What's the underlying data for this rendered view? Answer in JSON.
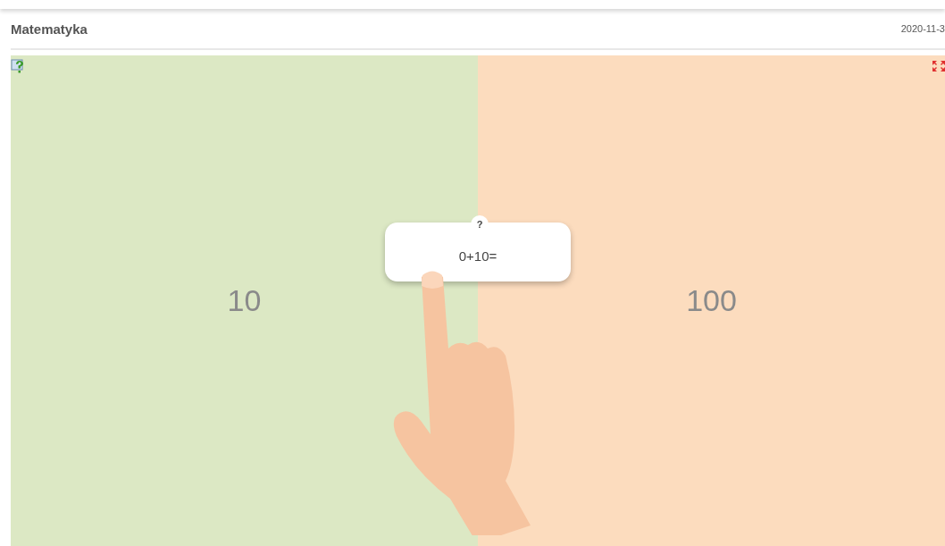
{
  "header": {
    "title": "Matematyka",
    "date": "2020-11-3"
  },
  "question": {
    "mark": "?",
    "text": "0+10="
  },
  "answers": [
    {
      "text": "10",
      "color": "#dce8c4"
    },
    {
      "text": "100",
      "color": "#fcdcbe"
    }
  ]
}
